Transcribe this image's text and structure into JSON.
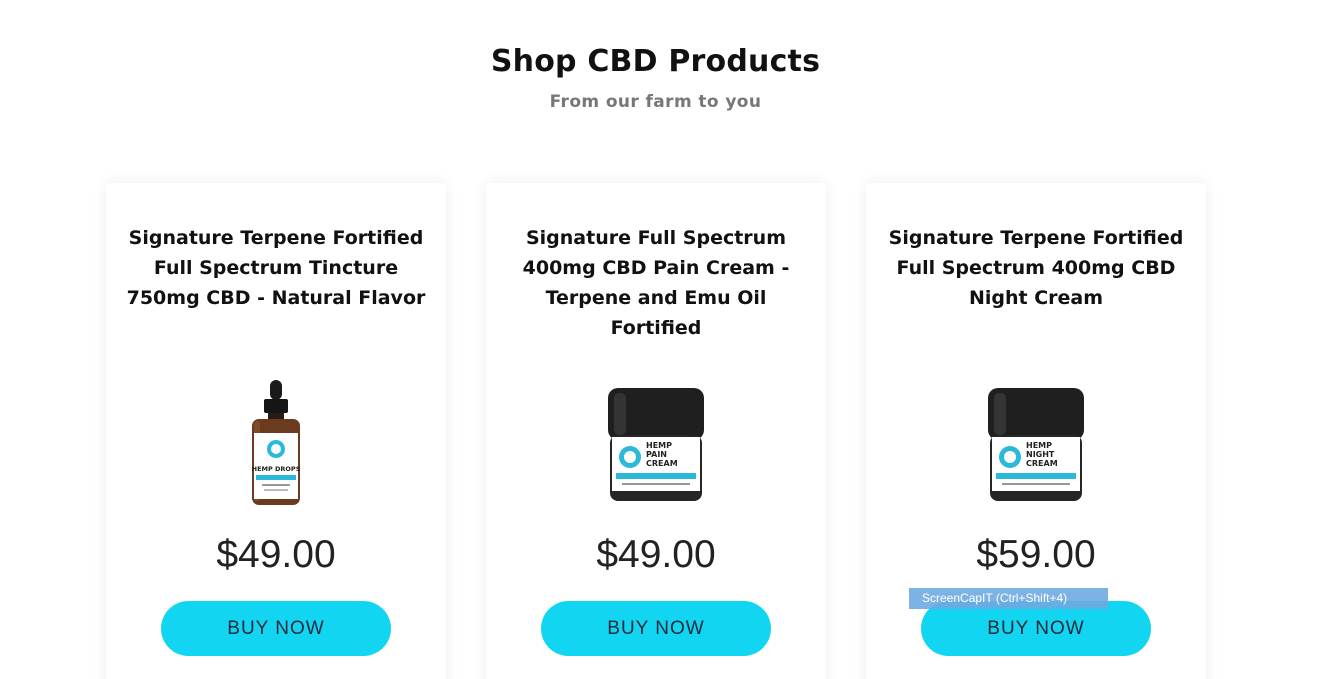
{
  "header": {
    "title": "Shop CBD Products",
    "subtitle": "From our farm to you"
  },
  "products": [
    {
      "title": "Signature Terpene Fortified Full Spectrum Tincture 750mg CBD - Natural Flavor",
      "price": "$49.00",
      "button_label": "BUY NOW",
      "image_icon": "tincture-bottle-icon",
      "label_text": "HEMP DROPS"
    },
    {
      "title": "Signature Full Spectrum 400mg CBD Pain Cream - Terpene and Emu Oil Fortified",
      "price": "$49.00",
      "button_label": "BUY NOW",
      "image_icon": "cream-jar-icon",
      "label_text": [
        "HEMP",
        "PAIN",
        "CREAM"
      ]
    },
    {
      "title": "Signature Terpene Fortified Full Spectrum 400mg CBD Night Cream",
      "price": "$59.00",
      "button_label": "BUY NOW",
      "image_icon": "cream-jar-icon",
      "label_text": [
        "HEMP",
        "NIGHT",
        "CREAM"
      ]
    }
  ],
  "overlay": {
    "tooltip": "ScreenCapIT  (Ctrl+Shift+4)"
  },
  "colors": {
    "button": "#12d5f2",
    "accent_label": "#2bb8d9"
  }
}
